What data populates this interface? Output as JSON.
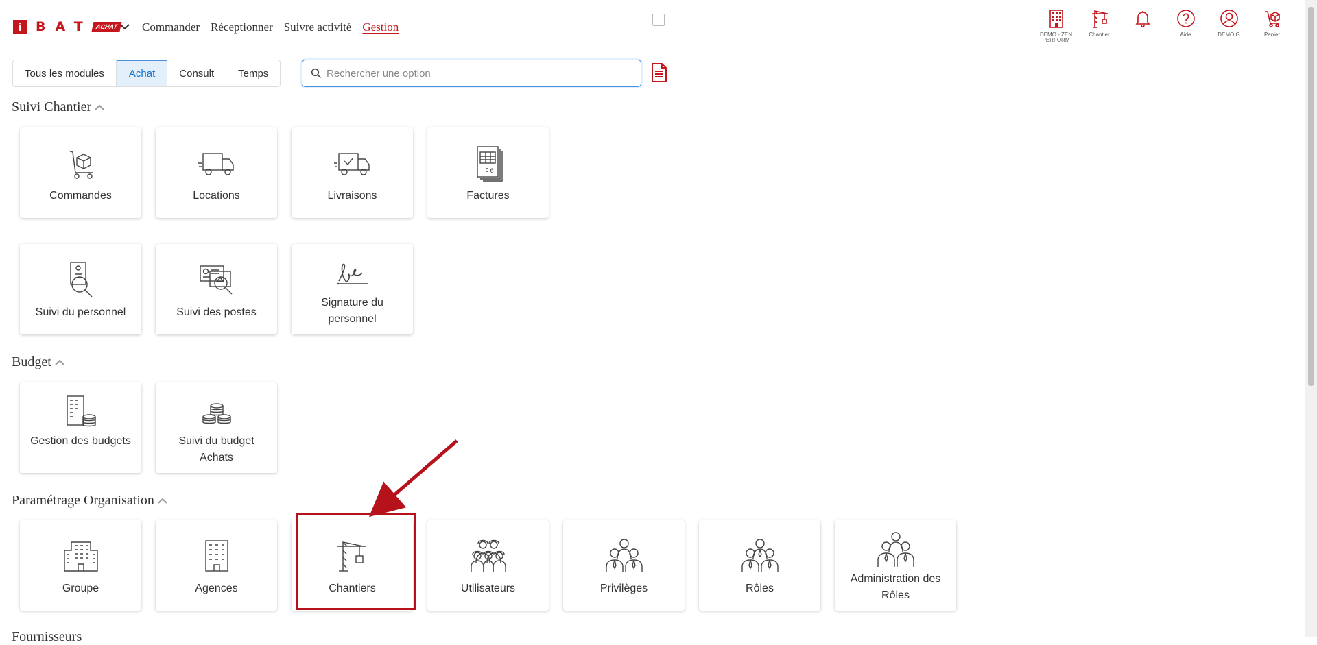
{
  "header": {
    "logo_letter": "i",
    "logo_text": "BAT",
    "logo_badge": "ACHAT",
    "nav": [
      "Commander",
      "Réceptionner",
      "Suivre activité",
      "Gestion"
    ],
    "active_nav": "Gestion",
    "icons": [
      {
        "name": "building-icon",
        "label": "DEMO - ZEN PERFORM"
      },
      {
        "name": "crane-icon",
        "label": "Chantier"
      },
      {
        "name": "bell-icon",
        "label": ""
      },
      {
        "name": "help-icon",
        "label": "Aide"
      },
      {
        "name": "user-icon",
        "label": "DEMO G"
      },
      {
        "name": "cart-icon",
        "label": "Panier"
      }
    ]
  },
  "filters": {
    "modules": [
      "Tous les modules",
      "Achat",
      "Consult",
      "Temps"
    ],
    "selected": "Achat",
    "search_placeholder": "Rechercher une option"
  },
  "sections": {
    "suivi": {
      "title": "Suivi Chantier",
      "items": [
        "Commandes",
        "Locations",
        "Livraisons",
        "Factures",
        "Suivi du personnel",
        "Suivi des postes",
        "Signature du personnel"
      ]
    },
    "budget": {
      "title": "Budget",
      "items": [
        "Gestion des budgets",
        "Suivi du budget Achats"
      ]
    },
    "parametrage": {
      "title": "Paramétrage Organisation",
      "items": [
        "Groupe",
        "Agences",
        "Chantiers",
        "Utilisateurs",
        "Privilèges",
        "Rôles",
        "Administration des Rôles"
      ]
    },
    "fournisseurs": {
      "title": "Fournisseurs"
    }
  },
  "colors": {
    "brand": "#c4161c",
    "selected_bg": "#e3f0fb",
    "selected_border": "#4a90d9",
    "annotation": "#b5121b"
  }
}
